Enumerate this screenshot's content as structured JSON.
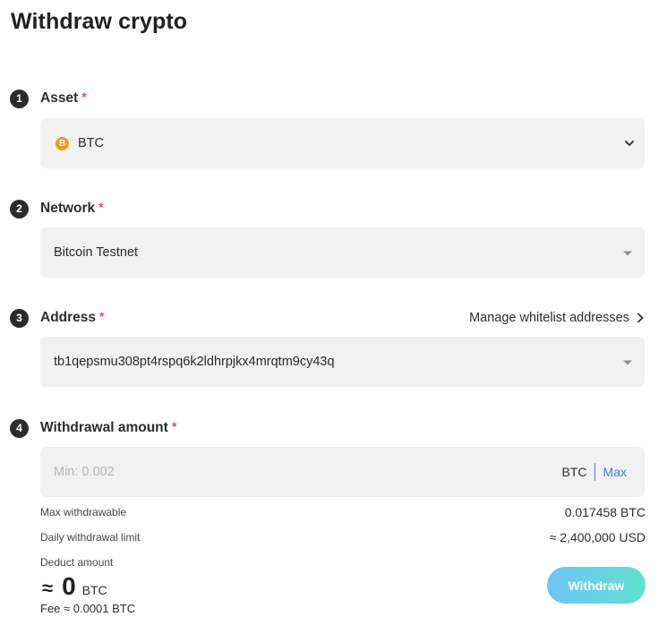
{
  "page": {
    "title": "Withdraw crypto"
  },
  "steps": [
    {
      "number": "1",
      "label": "Asset",
      "required": "*"
    },
    {
      "number": "2",
      "label": "Network",
      "required": "*"
    },
    {
      "number": "3",
      "label": "Address",
      "required": "*"
    },
    {
      "number": "4",
      "label": "Withdrawal amount",
      "required": "*"
    }
  ],
  "asset": {
    "icon": "bitcoin-icon",
    "icon_glyph": "B",
    "value": "BTC",
    "icon_color": "#f39a1e"
  },
  "network": {
    "value": "Bitcoin Testnet"
  },
  "address": {
    "manage_link": "Manage whitelist addresses",
    "value": "tb1qepsmu308pt4rspq6k2ldhrpjkx4mrqtm9cy43q"
  },
  "amount": {
    "placeholder": "Min: 0.002",
    "value": "",
    "unit": "BTC",
    "max_label": "Max"
  },
  "info": {
    "max_withdrawable_label": "Max withdrawable",
    "max_withdrawable_value": "0.017458 BTC",
    "daily_limit_label": "Daily withdrawal limit",
    "daily_limit_value": "≈ 2,400,000 USD",
    "deduct_label": "Deduct amount",
    "deduct_approx": "≈",
    "deduct_value": "0",
    "deduct_unit": "BTC",
    "fee": "Fee ≈ 0.0001 BTC"
  },
  "actions": {
    "withdraw_label": "Withdraw"
  },
  "colors": {
    "accent": "#3b7de1",
    "required": "#e8476f",
    "button_gradient_start": "#6fc4f5",
    "button_gradient_end": "#5fe1cf"
  }
}
